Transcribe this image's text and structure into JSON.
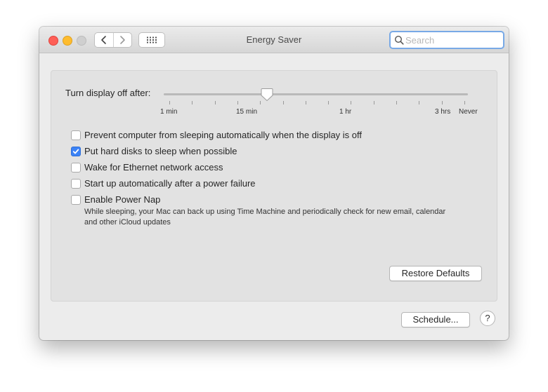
{
  "window": {
    "title": "Energy Saver"
  },
  "toolbar": {
    "back_icon": "chevron-left-icon",
    "forward_icon": "chevron-right-icon",
    "grid_icon": "show-all-grid-icon"
  },
  "search": {
    "placeholder": "Search",
    "value": ""
  },
  "display_slider": {
    "label": "Turn display off after:",
    "tick_labels": [
      "1 min",
      "15 min",
      "1 hr",
      "3 hrs",
      "Never"
    ],
    "value_label": "15 min"
  },
  "options": [
    {
      "label": "Prevent computer from sleeping automatically when the display is off",
      "checked": false
    },
    {
      "label": "Put hard disks to sleep when possible",
      "checked": true
    },
    {
      "label": "Wake for Ethernet network access",
      "checked": false
    },
    {
      "label": "Start up automatically after a power failure",
      "checked": false
    },
    {
      "label": "Enable Power Nap",
      "checked": false
    }
  ],
  "power_nap_description": "While sleeping, your Mac can back up using Time Machine and periodically check for new email, calendar and other iCloud updates",
  "buttons": {
    "restore_defaults": "Restore Defaults",
    "schedule": "Schedule...",
    "help": "?"
  },
  "colors": {
    "accent": "#3b82f6",
    "search_focus": "#78a9e6",
    "close": "#fe5f57",
    "minimize": "#febc2e",
    "zoom": "#cfcfcf"
  }
}
